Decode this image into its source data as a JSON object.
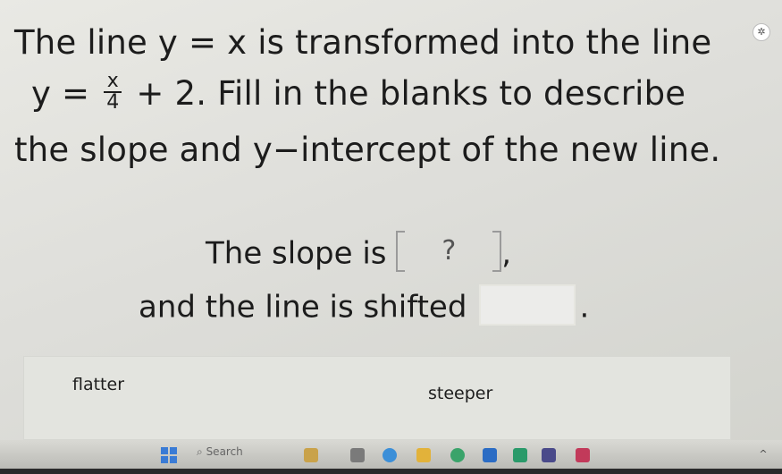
{
  "question": {
    "line1": "The line y = x is transformed into the line",
    "line2_prefix": "y = ",
    "frac_num": "x",
    "frac_den": "4",
    "line2_suffix": " + 2. Fill in the blanks to describe",
    "line3": "the slope and y−intercept of the new line."
  },
  "answer": {
    "slope_prefix": "The slope is",
    "slope_blank": "?",
    "slope_suffix": ",",
    "shift_prefix": "and the line is shifted",
    "shift_suffix": "."
  },
  "choices": {
    "flatter": "flatter",
    "steeper": "steeper"
  },
  "taskbar": {
    "search_label": "Search"
  },
  "icons": [
    "accessibility-icon",
    "windows-start-icon",
    "search-icon"
  ]
}
